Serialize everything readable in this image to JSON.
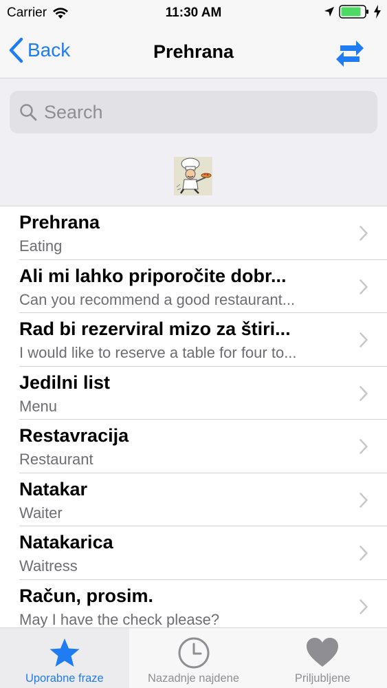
{
  "status": {
    "carrier": "Carrier",
    "time": "11:30 AM"
  },
  "nav": {
    "back_label": "Back",
    "title": "Prehrana"
  },
  "search": {
    "placeholder": "Search"
  },
  "list": [
    {
      "title": "Prehrana",
      "subtitle": "Eating"
    },
    {
      "title": "Ali mi lahko priporočite dobr...",
      "subtitle": "Can you recommend a good restaurant..."
    },
    {
      "title": "Rad bi rezerviral mizo za štiri...",
      "subtitle": "I would like to reserve a table for four to..."
    },
    {
      "title": "Jedilni list",
      "subtitle": "Menu"
    },
    {
      "title": "Restavracija",
      "subtitle": "Restaurant"
    },
    {
      "title": "Natakar",
      "subtitle": "Waiter"
    },
    {
      "title": "Natakarica",
      "subtitle": "Waitress"
    },
    {
      "title": "Račun, prosim.",
      "subtitle": "May I have the check please?"
    }
  ],
  "tabs": [
    {
      "label": "Uporabne fraze",
      "icon": "star-icon",
      "active": true
    },
    {
      "label": "Nazadnje najdene",
      "icon": "clock-icon",
      "active": false
    },
    {
      "label": "Priljubljene",
      "icon": "heart-icon",
      "active": false
    }
  ],
  "colors": {
    "accent": "#1f7cf3",
    "battery": "#4cd964"
  }
}
